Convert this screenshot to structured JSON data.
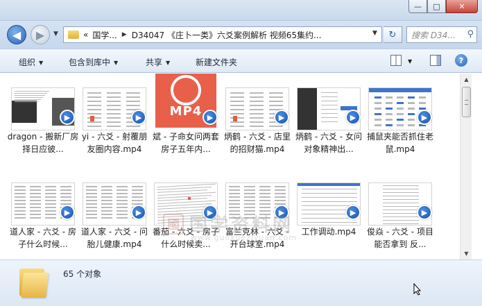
{
  "window": {
    "controls": {
      "minimize": "—",
      "maximize": "□",
      "close": "✕"
    }
  },
  "nav": {
    "back_glyph": "◀",
    "forward_glyph": "▶",
    "breadcrumbs": [
      "«",
      "国学...",
      "D34047 《庄卜一类》六爻案例解析 视频65集约..."
    ],
    "search_placeholder": "搜索 D34...",
    "refresh_glyph": "↻"
  },
  "toolbar": {
    "organize": "组织",
    "include_in_library": "包含到库中",
    "share": "共享",
    "new_folder": "新建文件夹",
    "help": "?"
  },
  "files": [
    {
      "name": "dragon - 搬新厂房择日应彼...",
      "thumb": "sheet-dark"
    },
    {
      "name": "yi - 六爻 - 射覆朋友圈内容.mp4",
      "thumb": "sheet-cols"
    },
    {
      "name": "斌 - 子命女问两套房子五年内...",
      "thumb": "mp4-doc"
    },
    {
      "name": "炳鹤 - 六爻 - 店里的招财猫.mp4",
      "thumb": "sheet-cols"
    },
    {
      "name": "炳鹤 - 六爻 - 女问对象精神出...",
      "thumb": "sheet-dark2"
    },
    {
      "name": "捕鼠夹能否抓住老鼠.mp4",
      "thumb": "sheet-blue"
    },
    {
      "name": "道人家 - 六爻 - 房子什么时候...",
      "thumb": "sheet-table"
    },
    {
      "name": "道人家 - 六爻 - 问胎儿健康.mp4",
      "thumb": "sheet-table"
    },
    {
      "name": "番茄 - 六爻 - 房子什么时候卖...",
      "thumb": "sheet-scan"
    },
    {
      "name": "富兰克林 - 六爻 - 开台球室.mp4",
      "thumb": "sheet-table"
    },
    {
      "name": "工作调动.mp4",
      "thumb": "sheet-list"
    },
    {
      "name": "俊焱 - 六爻 - 项目能否拿到 反...",
      "thumb": "sheet-narrow"
    }
  ],
  "watermark": {
    "seal": "國",
    "text": "国学资料网",
    "url": "www.guoxueziyuan.com"
  },
  "status": {
    "count": "65 个对象"
  },
  "colors": {
    "badge": "#1753a9",
    "mp4_brand": "#e8604a",
    "toolbar_bg": "#dfe9f5"
  }
}
